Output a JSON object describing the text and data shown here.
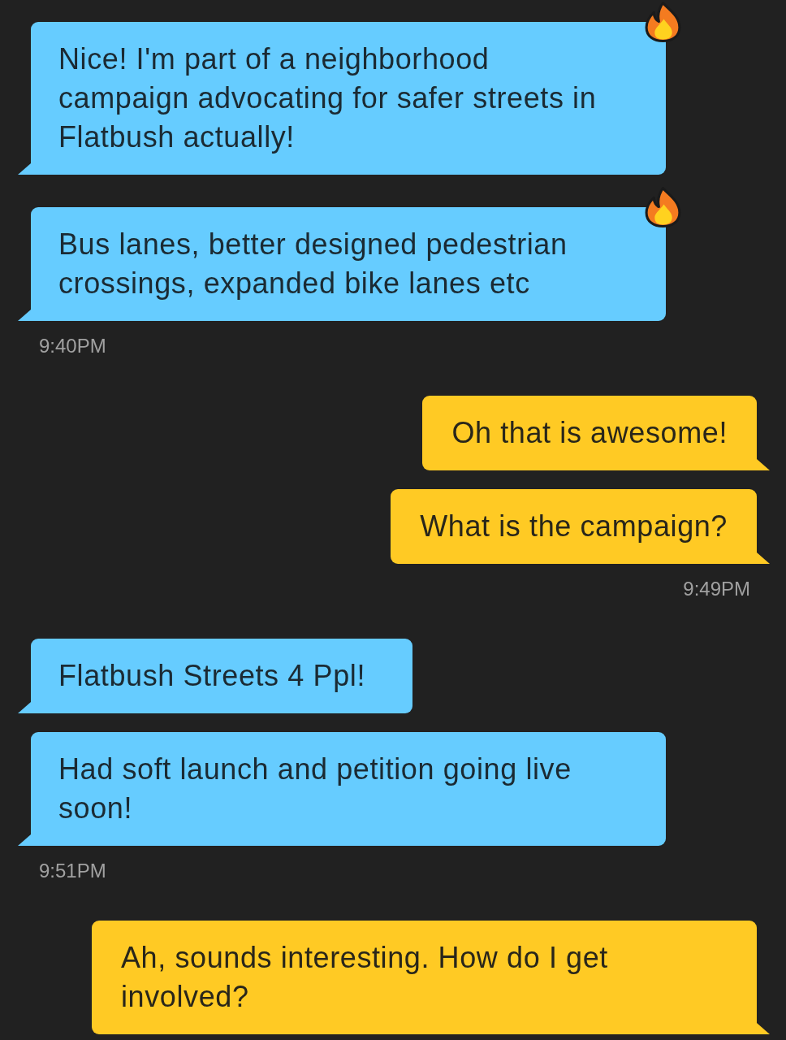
{
  "conversation": {
    "groups": [
      {
        "kind": "received",
        "messages": [
          {
            "text": "Nice! I'm part of a neighborhood campaign advocating for safer streets in Flatbush actually!",
            "reacted": true
          },
          {
            "text": "Bus lanes, better designed pedestrian crossings, expanded bike lanes etc",
            "reacted": true
          }
        ],
        "time": "9:40PM"
      },
      {
        "kind": "sent",
        "messages": [
          {
            "text": "Oh that is awesome!",
            "reacted": false
          },
          {
            "text": "What is the campaign?",
            "reacted": false
          }
        ],
        "time": "9:49PM"
      },
      {
        "kind": "received",
        "messages": [
          {
            "text": "Flatbush Streets 4 Ppl!",
            "reacted": false
          },
          {
            "text": "Had soft launch and petition going live soon!",
            "reacted": false
          }
        ],
        "time": "9:51PM"
      },
      {
        "kind": "sent",
        "messages": [
          {
            "text": "Ah, sounds interesting. How do I get involved?",
            "reacted": false
          }
        ]
      }
    ]
  }
}
